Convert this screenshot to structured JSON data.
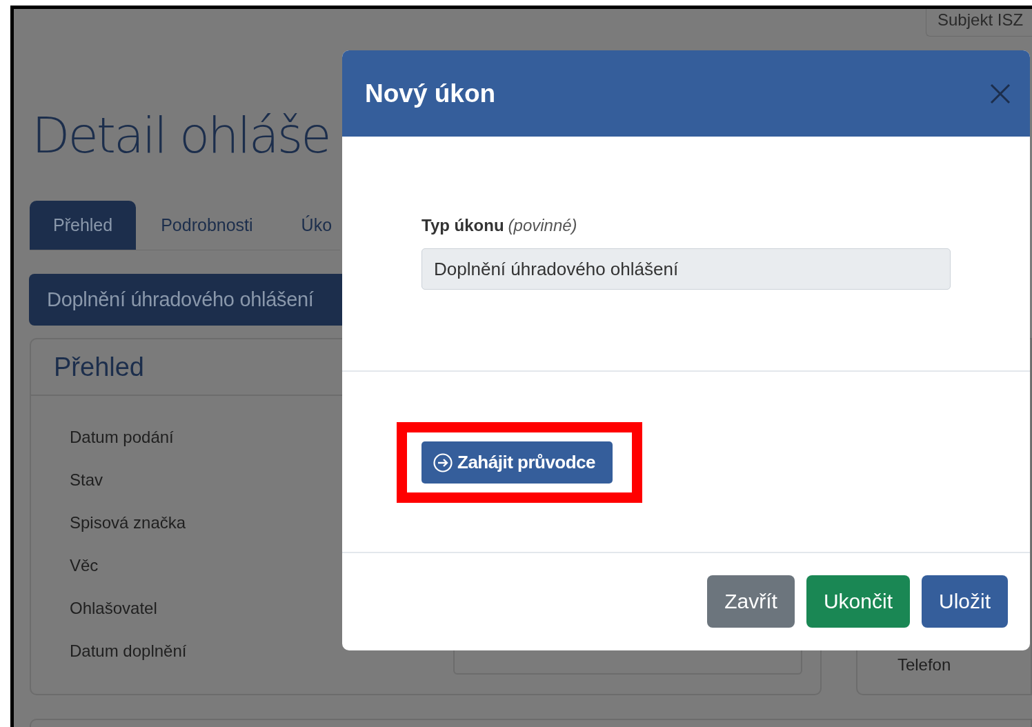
{
  "header_button": {
    "label": "Subjekt ISZ"
  },
  "page": {
    "title": "Detail ohláše",
    "tabs": [
      {
        "label": "Přehled",
        "selected": true
      },
      {
        "label": "Podrobnosti",
        "selected": false
      },
      {
        "label": "Úko",
        "selected": false
      }
    ],
    "banner": "Doplnění úhradového ohlášení",
    "card": {
      "title": "Přehled",
      "fields": [
        "Datum podání",
        "Stav",
        "Spisová značka",
        "Věc",
        "Ohlašovatel",
        "Datum doplnění"
      ]
    },
    "side_card": {
      "label": "Telefon"
    }
  },
  "modal": {
    "title": "Nový úkon",
    "field": {
      "label": "Typ úkonu",
      "hint": "(povinné)",
      "value": "Doplnění úhradového ohlášení",
      "disabled": true
    },
    "wizard_button": {
      "label": "Zahájit průvodce",
      "highlighted": true
    },
    "buttons": [
      {
        "label": "Zavřít",
        "kind": "secondary"
      },
      {
        "label": "Ukončit",
        "kind": "success"
      },
      {
        "label": "Uložit",
        "kind": "primary"
      }
    ]
  }
}
